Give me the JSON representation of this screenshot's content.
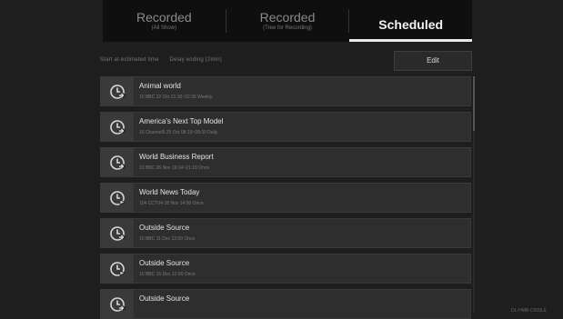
{
  "tabs": [
    {
      "title": "Recorded",
      "sub": "(All Show)"
    },
    {
      "title": "Recorded",
      "sub": "(Tree for Recording)"
    },
    {
      "title": "Scheduled",
      "sub": ""
    }
  ],
  "subbar": {
    "info_left": "Start at estimated time",
    "info_right": "Delay ending (2min)",
    "edit_label": "Edit"
  },
  "items": [
    {
      "name": "Animal world",
      "meta": "10 BBC  22 Oct  21:10~22:30  Weekly",
      "icon": "clock-repeat-icon"
    },
    {
      "name": "America's Next Top Model",
      "meta": "16 Channel5  25 Oct  08:19~09:30  Daily",
      "icon": "clock-repeat-icon"
    },
    {
      "name": "World Business Report",
      "meta": "10 BBC  26 Nov  19:14~21:18  Once",
      "icon": "clock-repeat-icon"
    },
    {
      "name": "World News Today",
      "meta": "104 CCTV4  18 Nov  14:00  Once",
      "icon": "clock-play-icon"
    },
    {
      "name": "Outside Source",
      "meta": "10 BBC  11 Dec  12:00  Once",
      "icon": "clock-repeat-icon"
    },
    {
      "name": "Outside Source",
      "meta": "10 BBC  15 Dec  12:00  Once",
      "icon": "clock-play-icon"
    },
    {
      "name": "Outside Source",
      "meta": "",
      "icon": "clock-repeat-icon"
    }
  ],
  "footer_code": "DL-HMB-C000LE"
}
